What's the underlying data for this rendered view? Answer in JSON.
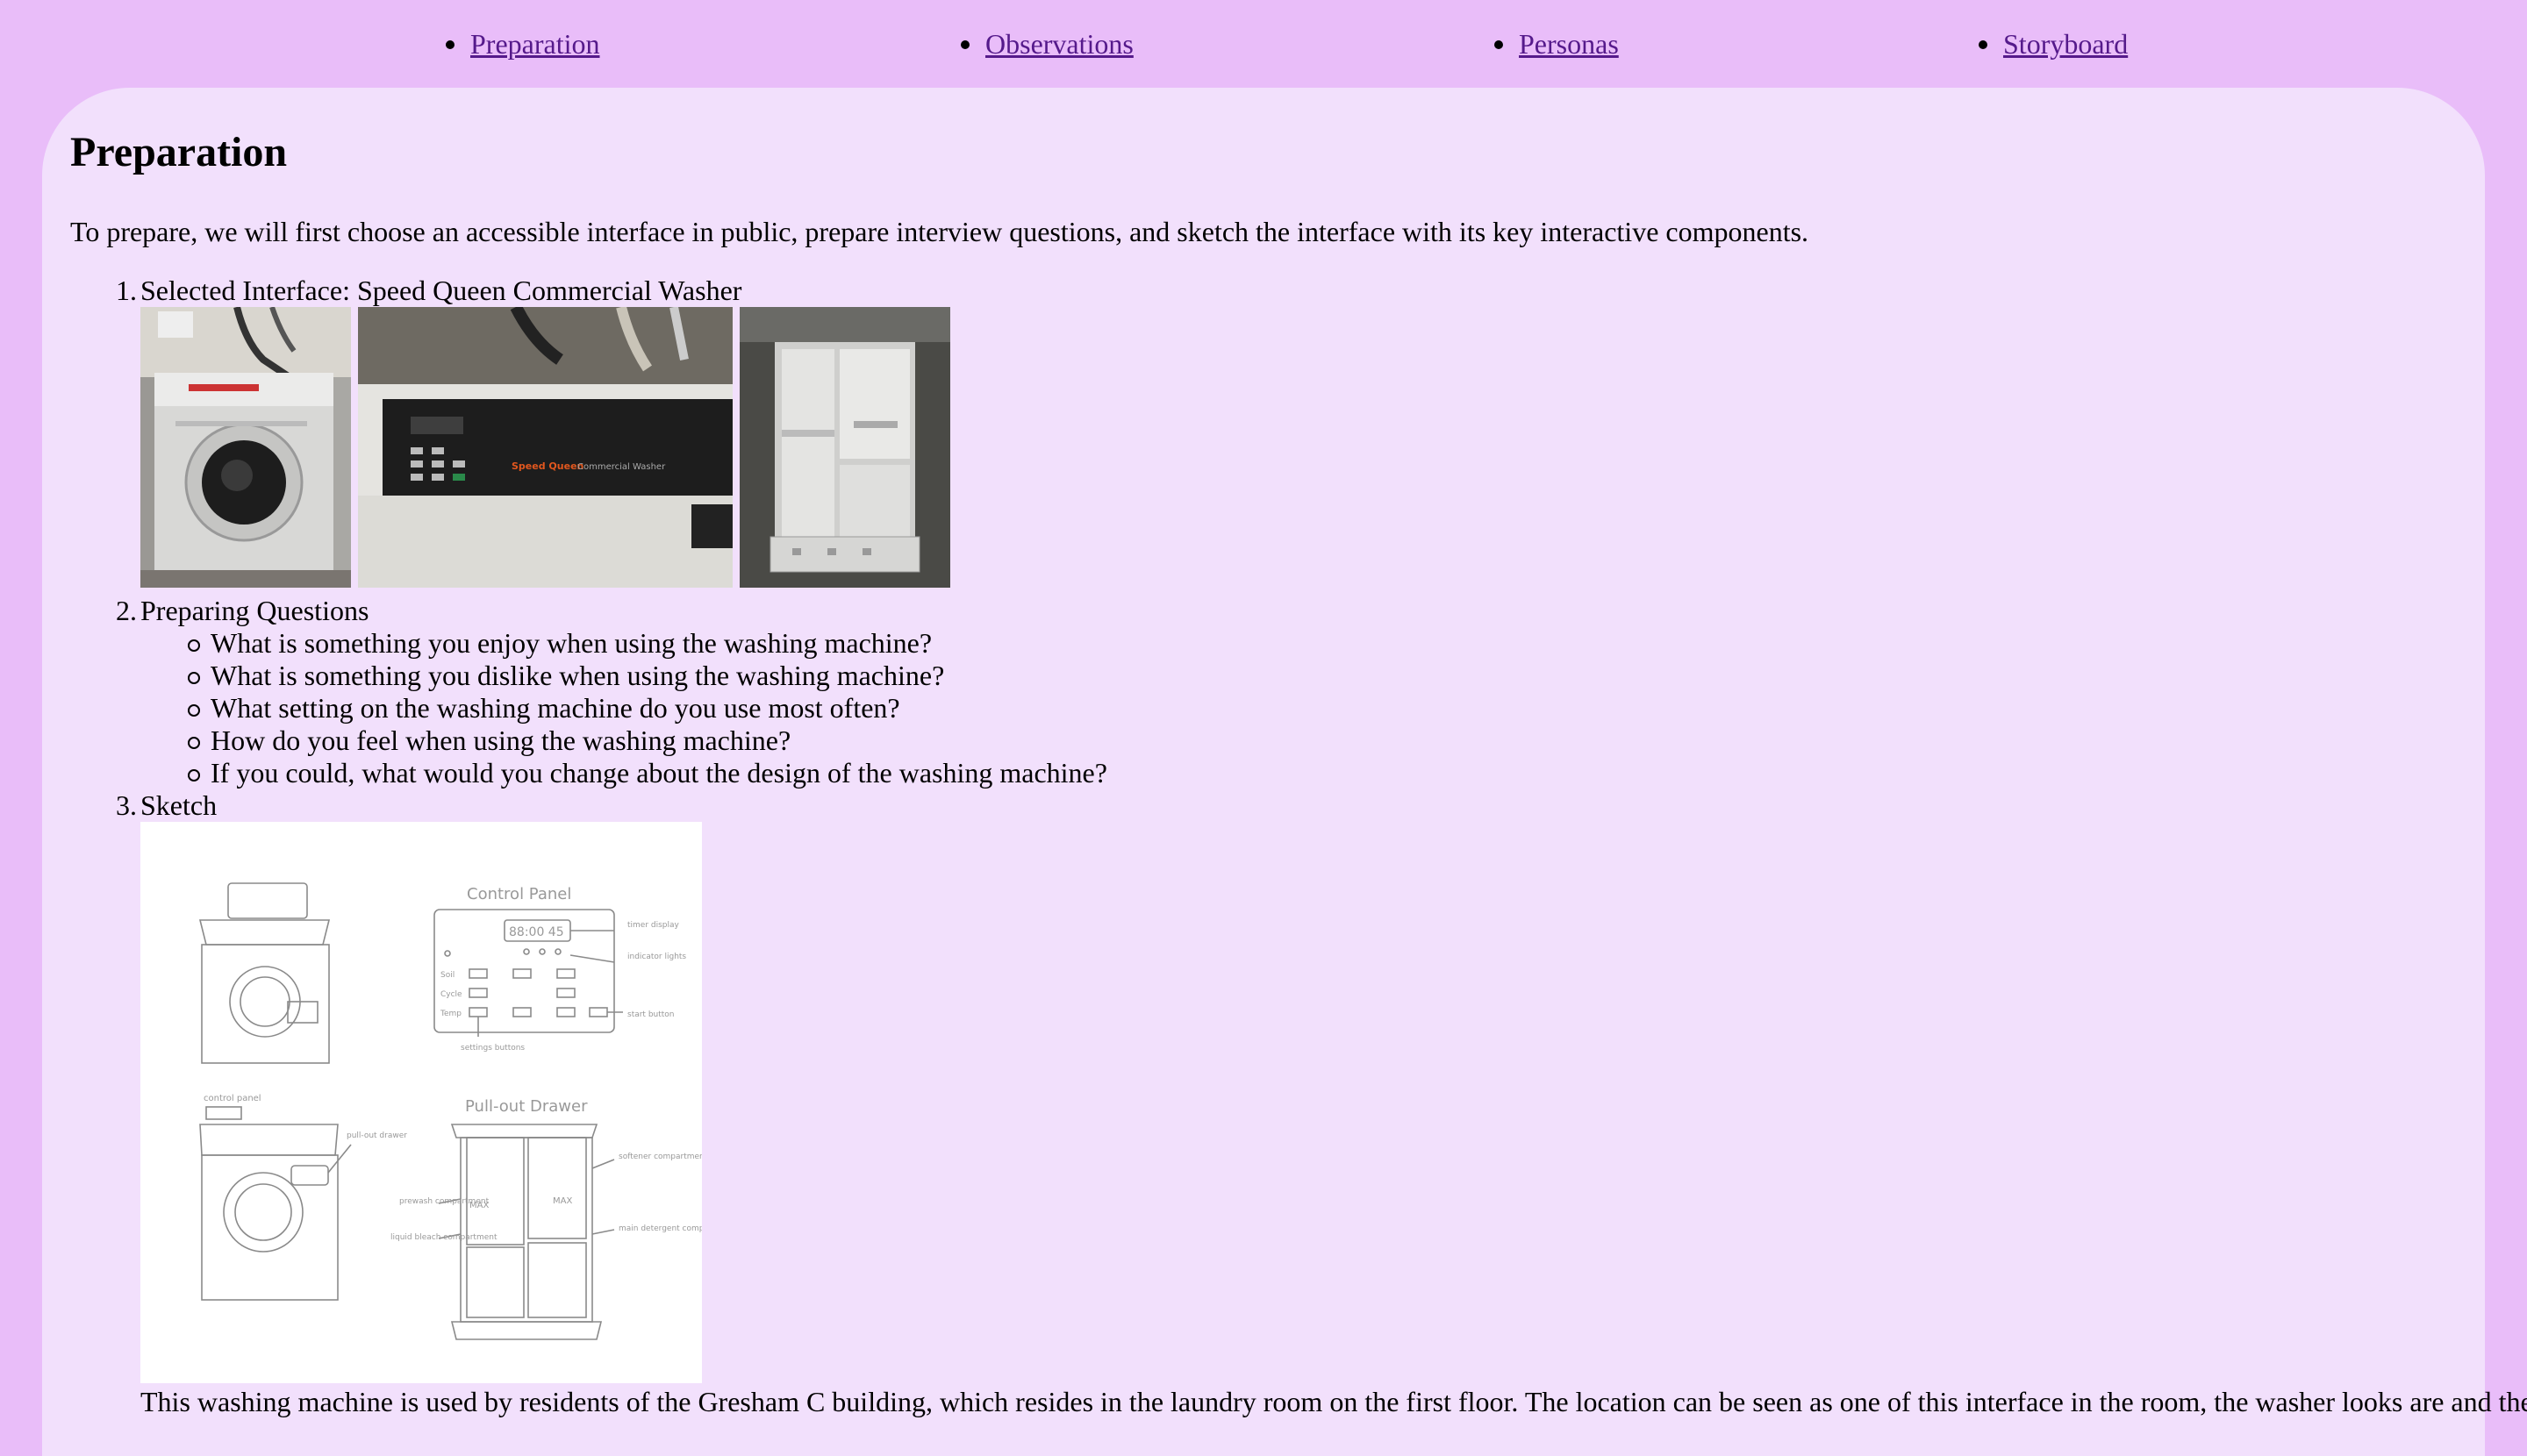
{
  "nav": {
    "items": [
      {
        "label": "Preparation"
      },
      {
        "label": "Observations"
      },
      {
        "label": "Personas"
      },
      {
        "label": "Storyboard"
      }
    ]
  },
  "page": {
    "title": "Preparation",
    "intro": "To prepare, we will first choose an accessible interface in public, prepare interview questions, and sketch the interface with its key interactive components."
  },
  "steps": [
    {
      "num": "1.",
      "label": "Selected Interface: Speed Queen Commercial Washer"
    },
    {
      "num": "2.",
      "label": "Preparing Questions"
    },
    {
      "num": "3.",
      "label": "Sketch"
    }
  ],
  "questions": [
    "What is something you enjoy when using the washing machine?",
    "What is something you dislike when using the washing machine?",
    "What setting on the washing machine do you use most often?",
    "How do you feel when using the washing machine?",
    "If you could, what would you change about the design of the washing machine?"
  ],
  "photos": {
    "brand_text": "Speed Queen",
    "model_text": "Commercial Washer"
  },
  "sketch": {
    "control_panel_title": "Control Panel",
    "drawer_title": "Pull-out Drawer",
    "timer_display": "88:00 45",
    "labels": {
      "timer": "timer display",
      "indicator": "indicator lights",
      "start": "start button",
      "settings": "settings buttons",
      "control_panel": "control panel",
      "pull_out": "pull-out drawer",
      "soil": "Soil",
      "cycle": "Cycle",
      "temp": "Temp",
      "softener": "softener compartment",
      "liquid_bleach": "liquid bleach compartment",
      "prewash": "prewash compartment",
      "detergent": "main detergent compartment",
      "max": "MAX"
    }
  },
  "trailing_text": "This washing machine is used by residents of the Gresham C building, which resides in the laundry room on the first floor. The location can be seen as one of this interface in the room, the washer looks are and the"
}
